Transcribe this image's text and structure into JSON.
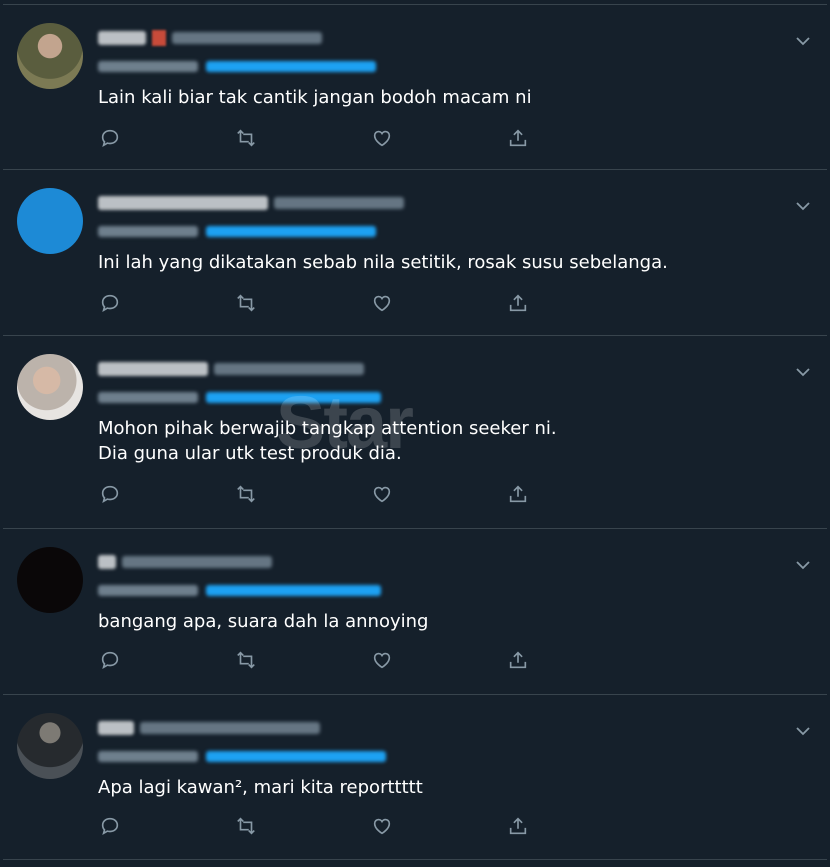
{
  "tweets": [
    {
      "text": "Lain kali biar tak cantik jangan bodoh macam ni",
      "avatar_color": "#6b6a4e"
    },
    {
      "text": "Ini lah yang dikatakan sebab nila setitik, rosak susu sebelanga.",
      "avatar_color": "#1d8ad6"
    },
    {
      "text": "Mohon pihak berwajib tangkap attention seeker ni.\nDia guna ular utk test produk dia.",
      "avatar_color": "#c9c0b8"
    },
    {
      "text": "bangang apa, suara dah la annoying",
      "avatar_color": "#0a0708"
    },
    {
      "text": "Apa lagi kawan², mari kita reporttttt",
      "avatar_color": "#3a3e42"
    }
  ],
  "watermark": "Star",
  "colors": {
    "background": "#15202b",
    "border": "#38444d",
    "icon": "#8899a6",
    "link": "#1da1f2"
  }
}
